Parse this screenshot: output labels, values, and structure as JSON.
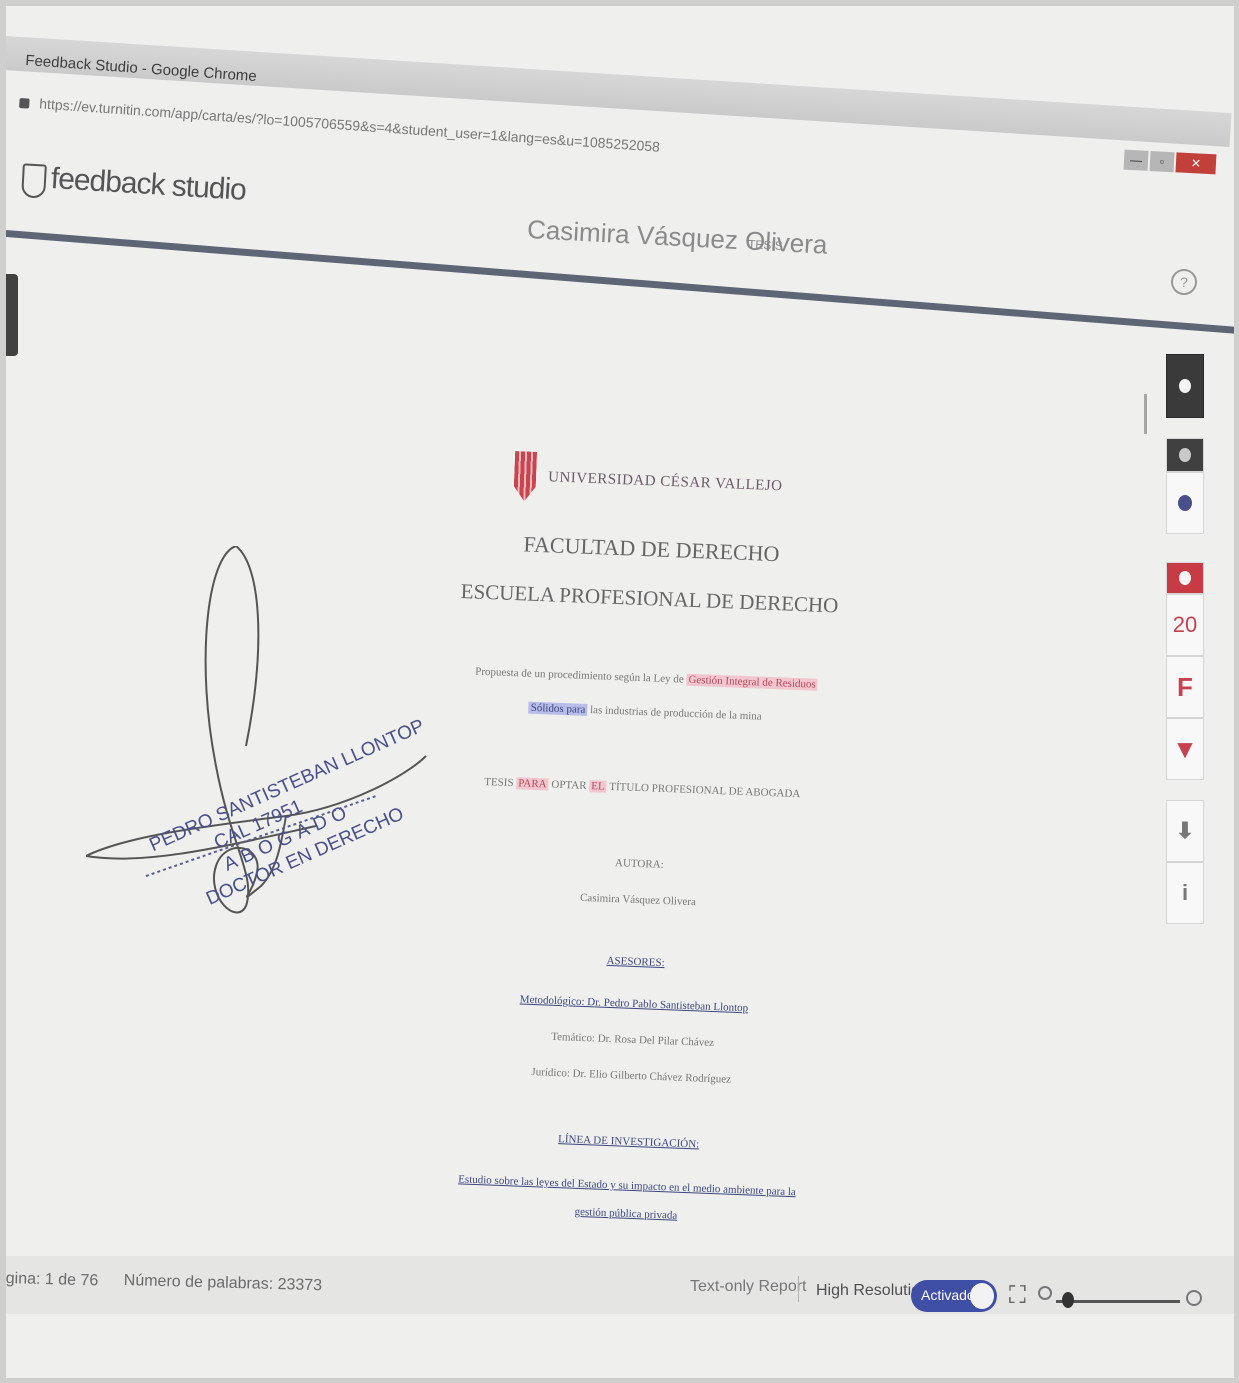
{
  "window": {
    "title": "Feedback Studio - Google Chrome",
    "url": "https://ev.turnitin.com/app/carta/es/?lo=1005706559&s=4&student_user=1&lang=es&u=1085252058",
    "controls": [
      "—",
      "▫",
      "✕"
    ]
  },
  "app": {
    "logo_text": "feedback studio",
    "student_name": "Casimira Vásquez Olivera",
    "doc_type": "TESIS",
    "help_glyph": "?"
  },
  "side_panel": {
    "similarity_score": "20",
    "icons": [
      "layers-icon",
      "comment-icon",
      "similarity-icon",
      "filter-settings-icon",
      "filter-icon",
      "download-icon",
      "info-icon"
    ],
    "filter_glyph": "F",
    "funnel_glyph": "▼",
    "download_glyph": "⬇",
    "info_glyph": "i"
  },
  "document": {
    "university": "UNIVERSIDAD CÉSAR VALLEJO",
    "faculty": "FACULTAD DE DERECHO",
    "school": "ESCUELA PROFESIONAL DE DERECHO",
    "title_line1_plain": "Propuesta de un procedimiento según la Ley de",
    "title_line1_highlight": "Gestión Integral de Residuos",
    "title_line2_highlight": "Sólidos para",
    "title_line2_plain": "las industrias de producción de la mina",
    "thesis_line_plain1": "TESIS",
    "thesis_line_highlight1": "PARA",
    "thesis_line_plain2": "OPTAR",
    "thesis_line_highlight2": "EL",
    "thesis_line_plain3": "TÍTULO PROFESIONAL DE ABOGADA",
    "author_label": "AUTORA:",
    "author_name": "Casimira Vásquez Olivera",
    "advisors_label": "ASESORES:",
    "advisor1": "Metodológico: Dr. Pedro Pablo Santisteban Llontop",
    "advisor2": "Temático: Dr. Rosa Del Pilar Chávez",
    "advisor3": "Jurídico: Dr. Elio Gilberto Chávez Rodríguez",
    "research_line_label": "LÍNEA DE INVESTIGACIÓN:",
    "research_line1": "Estudio sobre las leyes del Estado y su impacto en el medio ambiente para la",
    "research_line2": "gestión pública privada"
  },
  "stamp": {
    "name": "PEDRO SANTISTEBAN LLONTOP",
    "cal": "CAL 17951",
    "role": "ABOGADO",
    "degree": "DOCTOR EN DERECHO"
  },
  "status_bar": {
    "page_info": "gina: 1 de 76",
    "word_count": "Número de palabras: 23373",
    "text_only_report": "Text-only Report",
    "high_resolution_label": "High Resolution",
    "toggle_label": "Activado",
    "zoom_level": 0.1
  },
  "colors": {
    "accent_blue": "#3f4fa6",
    "turnitin_red": "#c94150",
    "header_rule": "#5e6676"
  }
}
